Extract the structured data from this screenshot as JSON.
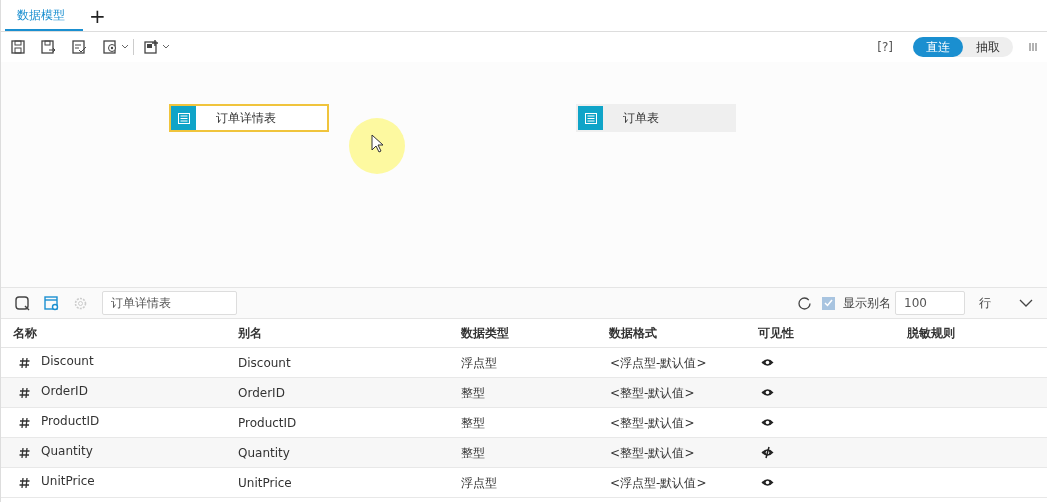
{
  "tabs": [
    {
      "label": "数据模型",
      "selected": true
    }
  ],
  "add_tab": "+",
  "help": "[?]",
  "mode_toggle": [
    {
      "label": "直连",
      "selected": true
    },
    {
      "label": "抽取",
      "selected": false
    }
  ],
  "canvas": {
    "nodes": [
      {
        "label": "订单详情表",
        "selected": true
      },
      {
        "label": "订单表",
        "selected": false
      }
    ]
  },
  "panel": {
    "table_name": "订单详情表",
    "show_alias": {
      "label": "显示别名",
      "checked": true
    },
    "row_count": "100",
    "row_unit": "行"
  },
  "table": {
    "columns": [
      "名称",
      "别名",
      "数据类型",
      "数据格式",
      "可见性",
      "脱敏规则"
    ],
    "rows": [
      {
        "name": "Discount",
        "alias": "Discount",
        "type": "浮点型",
        "format": "<浮点型-默认值>",
        "visible": true
      },
      {
        "name": "OrderID",
        "alias": "OrderID",
        "type": "整型",
        "format": "<整型-默认值>",
        "visible": true
      },
      {
        "name": "ProductID",
        "alias": "ProductID",
        "type": "整型",
        "format": "<整型-默认值>",
        "visible": true
      },
      {
        "name": "Quantity",
        "alias": "Quantity",
        "type": "整型",
        "format": "<整型-默认值>",
        "visible": false
      },
      {
        "name": "UnitPrice",
        "alias": "UnitPrice",
        "type": "浮点型",
        "format": "<浮点型-默认值>",
        "visible": true
      }
    ]
  }
}
